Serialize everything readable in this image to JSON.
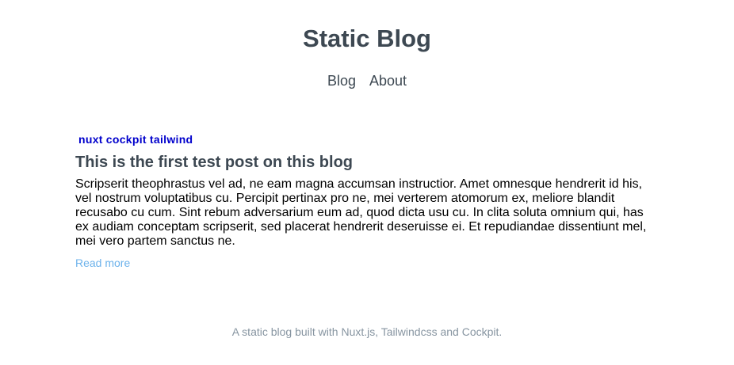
{
  "header": {
    "site_title": "Static Blog",
    "nav": [
      "Blog",
      "About"
    ]
  },
  "post": {
    "tags": [
      "nuxt",
      "cockpit",
      "tailwind"
    ],
    "title": "This is the first test post on this blog",
    "excerpt": "Scripserit theophrastus vel ad, ne eam magna accumsan instructior. Amet omnesque hendrerit id his, vel nostrum voluptatibus cu. Percipit pertinax pro ne, mei verterem atomorum ex, meliore blandit recusabo cu cum. Sint rebum adversarium eum ad, quod dicta usu cu. In clita soluta omnium qui, has ex audiam conceptam scripserit, sed placerat hendrerit deseruisse ei. Et repudiandae dissentiunt mel, mei vero partem sanctus ne.",
    "read_more": "Read more"
  },
  "footer": {
    "text": "A static blog built with Nuxt.js, Tailwindcss and Cockpit."
  },
  "colors": {
    "heading": "#3d4852",
    "tag": "#0000cc",
    "link": "#6cb2eb",
    "footer": "#8795a1"
  }
}
